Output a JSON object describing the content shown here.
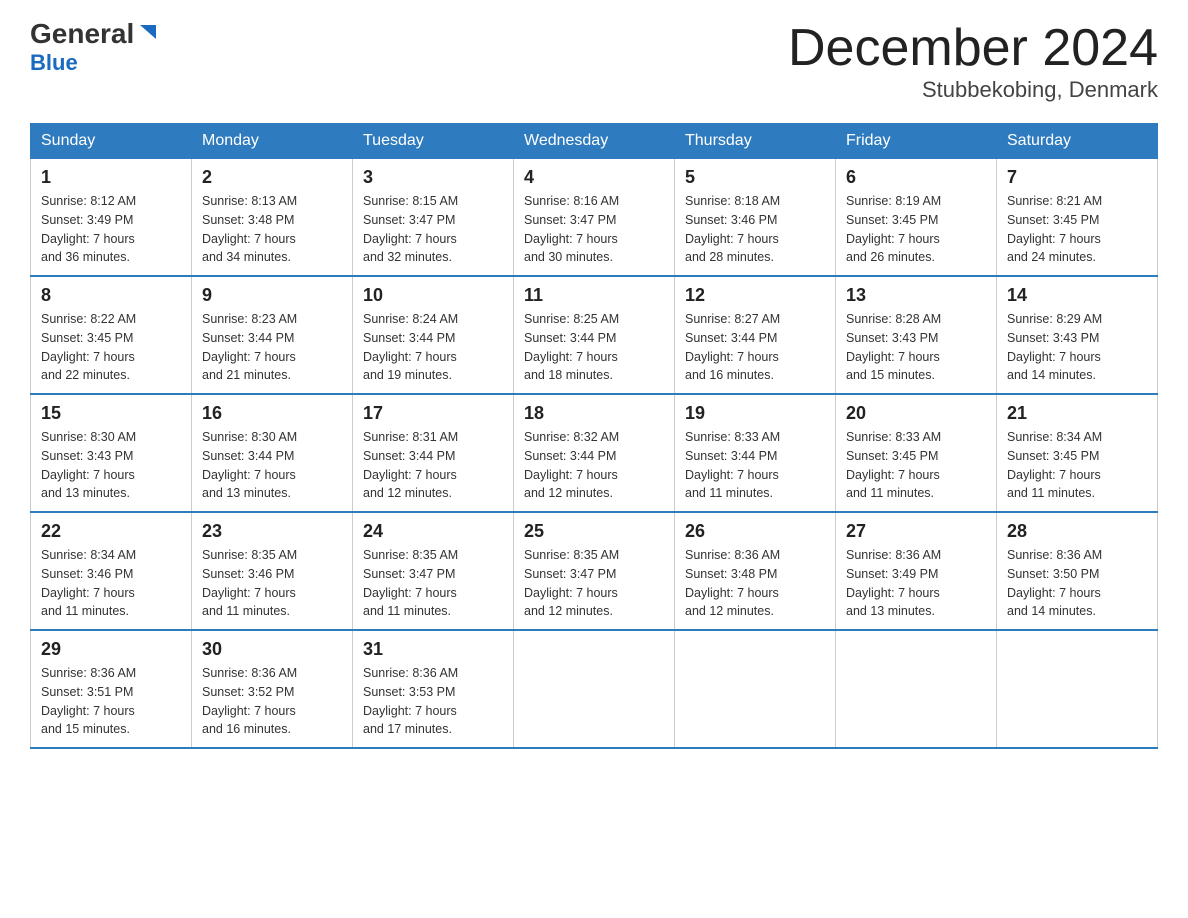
{
  "logo": {
    "general": "General",
    "blue": "Blue"
  },
  "title": "December 2024",
  "subtitle": "Stubbekobing, Denmark",
  "headers": [
    "Sunday",
    "Monday",
    "Tuesday",
    "Wednesday",
    "Thursday",
    "Friday",
    "Saturday"
  ],
  "weeks": [
    [
      {
        "day": "1",
        "sunrise": "8:12 AM",
        "sunset": "3:49 PM",
        "daylight": "7 hours and 36 minutes."
      },
      {
        "day": "2",
        "sunrise": "8:13 AM",
        "sunset": "3:48 PM",
        "daylight": "7 hours and 34 minutes."
      },
      {
        "day": "3",
        "sunrise": "8:15 AM",
        "sunset": "3:47 PM",
        "daylight": "7 hours and 32 minutes."
      },
      {
        "day": "4",
        "sunrise": "8:16 AM",
        "sunset": "3:47 PM",
        "daylight": "7 hours and 30 minutes."
      },
      {
        "day": "5",
        "sunrise": "8:18 AM",
        "sunset": "3:46 PM",
        "daylight": "7 hours and 28 minutes."
      },
      {
        "day": "6",
        "sunrise": "8:19 AM",
        "sunset": "3:45 PM",
        "daylight": "7 hours and 26 minutes."
      },
      {
        "day": "7",
        "sunrise": "8:21 AM",
        "sunset": "3:45 PM",
        "daylight": "7 hours and 24 minutes."
      }
    ],
    [
      {
        "day": "8",
        "sunrise": "8:22 AM",
        "sunset": "3:45 PM",
        "daylight": "7 hours and 22 minutes."
      },
      {
        "day": "9",
        "sunrise": "8:23 AM",
        "sunset": "3:44 PM",
        "daylight": "7 hours and 21 minutes."
      },
      {
        "day": "10",
        "sunrise": "8:24 AM",
        "sunset": "3:44 PM",
        "daylight": "7 hours and 19 minutes."
      },
      {
        "day": "11",
        "sunrise": "8:25 AM",
        "sunset": "3:44 PM",
        "daylight": "7 hours and 18 minutes."
      },
      {
        "day": "12",
        "sunrise": "8:27 AM",
        "sunset": "3:44 PM",
        "daylight": "7 hours and 16 minutes."
      },
      {
        "day": "13",
        "sunrise": "8:28 AM",
        "sunset": "3:43 PM",
        "daylight": "7 hours and 15 minutes."
      },
      {
        "day": "14",
        "sunrise": "8:29 AM",
        "sunset": "3:43 PM",
        "daylight": "7 hours and 14 minutes."
      }
    ],
    [
      {
        "day": "15",
        "sunrise": "8:30 AM",
        "sunset": "3:43 PM",
        "daylight": "7 hours and 13 minutes."
      },
      {
        "day": "16",
        "sunrise": "8:30 AM",
        "sunset": "3:44 PM",
        "daylight": "7 hours and 13 minutes."
      },
      {
        "day": "17",
        "sunrise": "8:31 AM",
        "sunset": "3:44 PM",
        "daylight": "7 hours and 12 minutes."
      },
      {
        "day": "18",
        "sunrise": "8:32 AM",
        "sunset": "3:44 PM",
        "daylight": "7 hours and 12 minutes."
      },
      {
        "day": "19",
        "sunrise": "8:33 AM",
        "sunset": "3:44 PM",
        "daylight": "7 hours and 11 minutes."
      },
      {
        "day": "20",
        "sunrise": "8:33 AM",
        "sunset": "3:45 PM",
        "daylight": "7 hours and 11 minutes."
      },
      {
        "day": "21",
        "sunrise": "8:34 AM",
        "sunset": "3:45 PM",
        "daylight": "7 hours and 11 minutes."
      }
    ],
    [
      {
        "day": "22",
        "sunrise": "8:34 AM",
        "sunset": "3:46 PM",
        "daylight": "7 hours and 11 minutes."
      },
      {
        "day": "23",
        "sunrise": "8:35 AM",
        "sunset": "3:46 PM",
        "daylight": "7 hours and 11 minutes."
      },
      {
        "day": "24",
        "sunrise": "8:35 AM",
        "sunset": "3:47 PM",
        "daylight": "7 hours and 11 minutes."
      },
      {
        "day": "25",
        "sunrise": "8:35 AM",
        "sunset": "3:47 PM",
        "daylight": "7 hours and 12 minutes."
      },
      {
        "day": "26",
        "sunrise": "8:36 AM",
        "sunset": "3:48 PM",
        "daylight": "7 hours and 12 minutes."
      },
      {
        "day": "27",
        "sunrise": "8:36 AM",
        "sunset": "3:49 PM",
        "daylight": "7 hours and 13 minutes."
      },
      {
        "day": "28",
        "sunrise": "8:36 AM",
        "sunset": "3:50 PM",
        "daylight": "7 hours and 14 minutes."
      }
    ],
    [
      {
        "day": "29",
        "sunrise": "8:36 AM",
        "sunset": "3:51 PM",
        "daylight": "7 hours and 15 minutes."
      },
      {
        "day": "30",
        "sunrise": "8:36 AM",
        "sunset": "3:52 PM",
        "daylight": "7 hours and 16 minutes."
      },
      {
        "day": "31",
        "sunrise": "8:36 AM",
        "sunset": "3:53 PM",
        "daylight": "7 hours and 17 minutes."
      },
      null,
      null,
      null,
      null
    ]
  ],
  "labels": {
    "sunrise": "Sunrise:",
    "sunset": "Sunset:",
    "daylight": "Daylight:"
  }
}
